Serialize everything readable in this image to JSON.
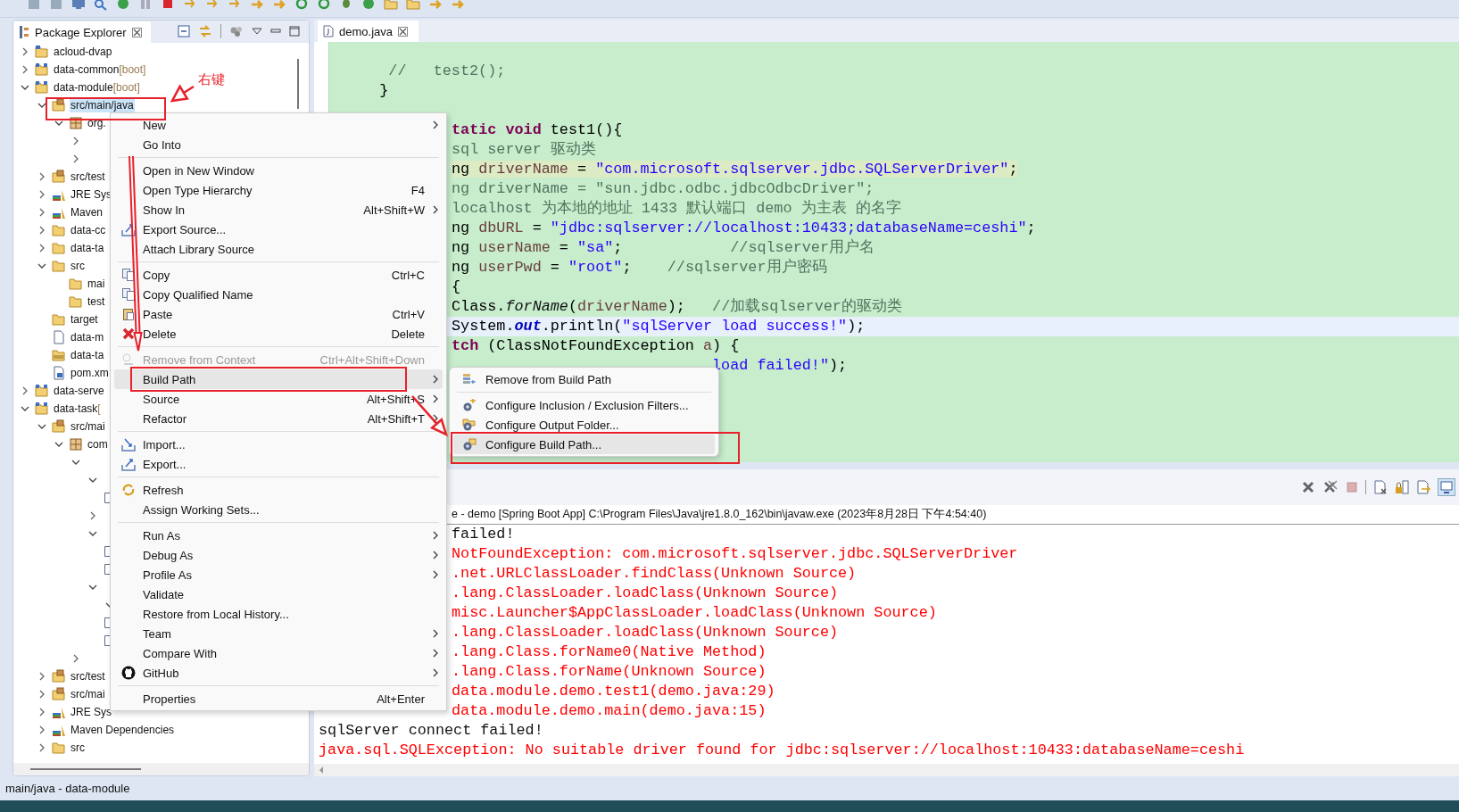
{
  "package_explorer": {
    "title": "Package Explorer",
    "tree": [
      {
        "kind": "project",
        "label": "acloud-dvap",
        "expanded": false,
        "selected": false
      },
      {
        "kind": "boot-project",
        "label": "data-common",
        "decoration": "[boot]",
        "expanded": false,
        "selected": false
      },
      {
        "kind": "boot-project",
        "label": "data-module",
        "decoration": "[boot]",
        "expanded": true,
        "selected": false,
        "children": [
          {
            "kind": "source-folder",
            "label": "src/main/java",
            "expanded": true,
            "selected": true,
            "children": [
              {
                "kind": "package",
                "label": "org.",
                "expanded": true,
                "selected": false,
                "children": [
                  {
                    "expanded": false
                  },
                  {
                    "expanded": false
                  }
                ]
              }
            ]
          },
          {
            "kind": "source-folder",
            "label": "src/test",
            "expanded": false,
            "selected": false
          },
          {
            "kind": "library",
            "label": "JRE Sys",
            "expanded": false,
            "selected": false
          },
          {
            "kind": "library",
            "label": "Maven",
            "expanded": false,
            "selected": false
          },
          {
            "kind": "folder",
            "label": "data-cc",
            "expanded": false,
            "selected": false
          },
          {
            "kind": "folder",
            "label": "data-ta",
            "expanded": false,
            "selected": false
          },
          {
            "kind": "folder",
            "label": "src",
            "expanded": true,
            "selected": false,
            "children": [
              {
                "kind": "folder",
                "label": "mai",
                "selected": false
              },
              {
                "kind": "folder",
                "label": "test",
                "selected": false
              }
            ]
          },
          {
            "kind": "folder",
            "label": "target",
            "selected": false
          },
          {
            "kind": "file",
            "label": "data-m",
            "selected": false
          },
          {
            "kind": "archive",
            "label": "data-ta",
            "selected": false
          },
          {
            "kind": "maven-file",
            "label": "pom.xm",
            "selected": false
          }
        ]
      },
      {
        "kind": "boot-project",
        "label": "data-serve",
        "expanded": false,
        "selected": false
      },
      {
        "kind": "boot-project",
        "label": "data-task",
        "decoration": "[",
        "expanded": true,
        "selected": false,
        "children": [
          {
            "kind": "source-folder",
            "label": "src/mai",
            "expanded": true,
            "selected": false,
            "children": [
              {
                "kind": "package",
                "label": "com",
                "expanded": true,
                "selected": false,
                "children": [
                  {
                    "expanded": true,
                    "children": [
                      {
                        "expanded": true,
                        "children": [
                          {
                            "kind": "java-file"
                          }
                        ]
                      },
                      {
                        "expanded": false
                      },
                      {
                        "expanded": true,
                        "children": [
                          {
                            "kind": "java-file"
                          },
                          {
                            "kind": "java-file"
                          }
                        ]
                      },
                      {
                        "expanded": true,
                        "children": [
                          {
                            "expanded": true
                          },
                          {
                            "kind": "java-file"
                          },
                          {
                            "kind": "java-file"
                          }
                        ]
                      }
                    ]
                  },
                  {
                    "expanded": false
                  }
                ]
              }
            ]
          },
          {
            "kind": "source-folder",
            "label": "src/test",
            "expanded": false,
            "selected": false
          },
          {
            "kind": "source-folder",
            "label": "src/mai",
            "expanded": false,
            "selected": false
          },
          {
            "kind": "library",
            "label": "JRE Sys",
            "expanded": false,
            "selected": false
          },
          {
            "kind": "library",
            "label": "Maven Dependencies",
            "expanded": false,
            "selected": false
          },
          {
            "kind": "folder",
            "label": "src",
            "expanded": false,
            "selected": false
          }
        ]
      }
    ]
  },
  "editor": {
    "tab": {
      "title": "demo.java",
      "selected": true
    },
    "top_lines": [
      {
        "current": false,
        "marked": false,
        "segments": [
          {
            "kind": "com",
            "text": "     //   test2();"
          }
        ]
      },
      {
        "current": false,
        "marked": false,
        "segments": [
          {
            "kind": "plain",
            "text": "    }"
          }
        ]
      }
    ],
    "lines": [
      {
        "current": false,
        "marked": false,
        "segments": [
          {
            "kind": "kw",
            "text": "tatic void"
          },
          {
            "kind": "plain",
            "text": " test1(){"
          }
        ]
      },
      {
        "current": false,
        "marked": false,
        "segments": [
          {
            "kind": "com",
            "text": "sql server 驱动类"
          }
        ]
      },
      {
        "current": false,
        "marked": true,
        "segments": [
          {
            "kind": "plain",
            "text": "ng "
          },
          {
            "kind": "var",
            "text": "driverName"
          },
          {
            "kind": "plain",
            "text": " = "
          },
          {
            "kind": "str",
            "text": "\"com.microsoft.sqlserver.jdbc.SQLServerDriver\""
          },
          {
            "kind": "plain",
            "text": ";"
          }
        ]
      },
      {
        "current": false,
        "marked": false,
        "segments": [
          {
            "kind": "com",
            "text": "ng driverName = \"sun.jdbc.odbc.jdbcOdbcDriver\";"
          }
        ]
      },
      {
        "current": false,
        "marked": false,
        "segments": [
          {
            "kind": "com",
            "text": "localhost 为本地的地址 1433 默认端口 demo 为主表 的名字"
          }
        ]
      },
      {
        "current": false,
        "marked": false,
        "segments": [
          {
            "kind": "plain",
            "text": "ng "
          },
          {
            "kind": "var",
            "text": "dbURL"
          },
          {
            "kind": "plain",
            "text": " = "
          },
          {
            "kind": "str",
            "text": "\"jdbc:sqlserver://localhost:10433;databaseName=ceshi\""
          },
          {
            "kind": "plain",
            "text": ";"
          }
        ]
      },
      {
        "current": false,
        "marked": false,
        "segments": [
          {
            "kind": "plain",
            "text": "ng "
          },
          {
            "kind": "var",
            "text": "userName"
          },
          {
            "kind": "plain",
            "text": " = "
          },
          {
            "kind": "str",
            "text": "\"sa\""
          },
          {
            "kind": "plain",
            "text": ";            "
          },
          {
            "kind": "com",
            "text": "//sqlserver用户名"
          }
        ]
      },
      {
        "current": false,
        "marked": false,
        "segments": [
          {
            "kind": "plain",
            "text": "ng "
          },
          {
            "kind": "var",
            "text": "userPwd"
          },
          {
            "kind": "plain",
            "text": " = "
          },
          {
            "kind": "str",
            "text": "\"root\""
          },
          {
            "kind": "plain",
            "text": ";    "
          },
          {
            "kind": "com",
            "text": "//sqlserver用户密码"
          }
        ]
      },
      {
        "current": false,
        "marked": false,
        "segments": [
          {
            "kind": "plain",
            "text": "{"
          }
        ]
      },
      {
        "current": false,
        "marked": false,
        "segments": [
          {
            "kind": "plain",
            "text": "Class."
          },
          {
            "kind": "method",
            "text": "forName"
          },
          {
            "kind": "plain",
            "text": "("
          },
          {
            "kind": "var",
            "text": "driverName"
          },
          {
            "kind": "plain",
            "text": ");   "
          },
          {
            "kind": "com",
            "text": "//加载sqlserver的驱动类"
          }
        ]
      },
      {
        "current": true,
        "marked": false,
        "segments": [
          {
            "kind": "plain",
            "text": "System."
          },
          {
            "kind": "field",
            "text": "out"
          },
          {
            "kind": "plain",
            "text": ".println("
          },
          {
            "kind": "str",
            "text": "\"sqlServer load success!\""
          },
          {
            "kind": "plain",
            "text": ");"
          }
        ]
      },
      {
        "current": false,
        "marked": false,
        "segments": [
          {
            "kind": "kw",
            "text": "tch"
          },
          {
            "kind": "plain",
            "text": " (ClassNotFoundException "
          },
          {
            "kind": "var",
            "text": "a"
          },
          {
            "kind": "plain",
            "text": ") {"
          }
        ]
      },
      {
        "current": false,
        "marked": false,
        "segments": [
          {
            "kind": "str",
            "text": "                             load failed!\""
          },
          {
            "kind": "plain",
            "text": ");"
          }
        ]
      }
    ]
  },
  "console": {
    "header": "e - demo [Spring Boot App] C:\\Program Files\\Java\\jre1.8.0_162\\bin\\javaw.exe (2023年8月28日 下午4:54:40)",
    "lines": [
      {
        "error": false,
        "text": "failed!"
      },
      {
        "error": true,
        "text": "NotFoundException: com.microsoft.sqlserver.jdbc.SQLServerDriver"
      },
      {
        "error": true,
        "text": ".net.URLClassLoader.findClass(Unknown Source)"
      },
      {
        "error": true,
        "text": ".lang.ClassLoader.loadClass(Unknown Source)"
      },
      {
        "error": true,
        "text": "misc.Launcher$AppClassLoader.loadClass(Unknown Source)"
      },
      {
        "error": true,
        "text": ".lang.ClassLoader.loadClass(Unknown Source)"
      },
      {
        "error": true,
        "text": ".lang.Class.forName0(Native Method)"
      },
      {
        "error": true,
        "text": ".lang.Class.forName(Unknown Source)"
      },
      {
        "error": true,
        "text": "data.module.demo.test1(demo.java:29)"
      },
      {
        "error": true,
        "text": "data.module.demo.main(demo.java:15)"
      }
    ],
    "lines_below_menu": [
      {
        "error": false,
        "text": "sqlServer connect failed!"
      },
      {
        "error": true,
        "text": "java.sql.SQLException: No suitable driver found for jdbc:sqlserver://localhost:10433:databaseName=ceshi"
      }
    ]
  },
  "context_menu": {
    "items": [
      {
        "kind": "item",
        "label": "New",
        "submenu": true,
        "disabled": false,
        "selected": false
      },
      {
        "kind": "item",
        "label": "Go Into",
        "submenu": false,
        "disabled": false,
        "selected": false
      },
      {
        "kind": "separator"
      },
      {
        "kind": "item",
        "label": "Open in New Window",
        "submenu": false,
        "disabled": false,
        "selected": false
      },
      {
        "kind": "item",
        "label": "Open Type Hierarchy",
        "shortcut": "F4",
        "submenu": false,
        "disabled": false,
        "selected": false
      },
      {
        "kind": "item",
        "label": "Show In",
        "shortcut": "Alt+Shift+W",
        "submenu": true,
        "disabled": false,
        "selected": false
      },
      {
        "kind": "export-source",
        "label": "Export Source...",
        "submenu": false,
        "disabled": false,
        "selected": false
      },
      {
        "kind": "item",
        "label": "Attach Library Source",
        "submenu": false,
        "disabled": false,
        "selected": false
      },
      {
        "kind": "separator"
      },
      {
        "kind": "copy",
        "label": "Copy",
        "shortcut": "Ctrl+C",
        "submenu": false,
        "disabled": false,
        "selected": false
      },
      {
        "kind": "copy",
        "label": "Copy Qualified Name",
        "submenu": false,
        "disabled": false,
        "selected": false
      },
      {
        "kind": "paste",
        "label": "Paste",
        "shortcut": "Ctrl+V",
        "submenu": false,
        "disabled": false,
        "selected": false
      },
      {
        "kind": "delete",
        "label": "Delete",
        "shortcut": "Delete",
        "submenu": false,
        "disabled": false,
        "selected": false
      },
      {
        "kind": "separator"
      },
      {
        "kind": "remove",
        "label": "Remove from Context",
        "shortcut": "Ctrl+Alt+Shift+Down",
        "submenu": false,
        "disabled": true,
        "selected": false
      },
      {
        "kind": "item",
        "label": "Build Path",
        "submenu": true,
        "disabled": false,
        "selected": true
      },
      {
        "kind": "item",
        "label": "Source",
        "shortcut": "Alt+Shift+S",
        "submenu": true,
        "disabled": false,
        "selected": false
      },
      {
        "kind": "item",
        "label": "Refactor",
        "shortcut": "Alt+Shift+T",
        "submenu": true,
        "disabled": false,
        "selected": false
      },
      {
        "kind": "separator"
      },
      {
        "kind": "import",
        "label": "Import...",
        "submenu": false,
        "disabled": false,
        "selected": false
      },
      {
        "kind": "export",
        "label": "Export...",
        "submenu": false,
        "disabled": false,
        "selected": false
      },
      {
        "kind": "separator"
      },
      {
        "kind": "refresh",
        "label": "Refresh",
        "submenu": false,
        "disabled": false,
        "selected": false
      },
      {
        "kind": "item",
        "label": "Assign Working Sets...",
        "submenu": false,
        "disabled": false,
        "selected": false
      },
      {
        "kind": "separator"
      },
      {
        "kind": "item",
        "label": "Run As",
        "submenu": true,
        "disabled": false,
        "selected": false
      },
      {
        "kind": "item",
        "label": "Debug As",
        "submenu": true,
        "disabled": false,
        "selected": false
      },
      {
        "kind": "item",
        "label": "Profile As",
        "submenu": true,
        "disabled": false,
        "selected": false
      },
      {
        "kind": "item",
        "label": "Validate",
        "submenu": false,
        "disabled": false,
        "selected": false
      },
      {
        "kind": "item",
        "label": "Restore from Local History...",
        "submenu": false,
        "disabled": false,
        "selected": false
      },
      {
        "kind": "item",
        "label": "Team",
        "submenu": true,
        "disabled": false,
        "selected": false
      },
      {
        "kind": "item",
        "label": "Compare With",
        "submenu": true,
        "disabled": false,
        "selected": false
      },
      {
        "kind": "github",
        "label": "GitHub",
        "submenu": true,
        "disabled": false,
        "selected": false
      },
      {
        "kind": "separator"
      },
      {
        "kind": "item",
        "label": "Properties",
        "shortcut": "Alt+Enter",
        "submenu": false,
        "disabled": false,
        "selected": false
      }
    ]
  },
  "submenu": {
    "items": [
      {
        "kind": "library",
        "label": "Remove from Build Path",
        "submenu": false,
        "disabled": false,
        "selected": false
      },
      {
        "kind": "separator"
      },
      {
        "kind": "filter-gear",
        "label": "Configure Inclusion / Exclusion Filters...",
        "submenu": false,
        "disabled": false,
        "selected": false
      },
      {
        "kind": "folder-gear",
        "label": "Configure Output Folder...",
        "submenu": false,
        "disabled": false,
        "selected": false
      },
      {
        "kind": "build-gear",
        "label": "Configure Build Path...",
        "submenu": false,
        "disabled": false,
        "selected": true
      }
    ]
  },
  "annotation": {
    "label": "右键"
  },
  "status_bar": {
    "text": "main/java - data-module"
  }
}
